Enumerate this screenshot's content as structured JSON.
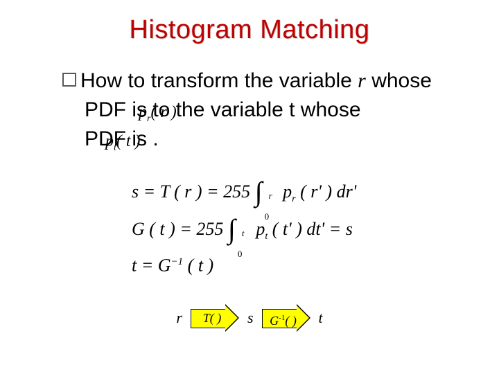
{
  "title": "Histogram Matching",
  "bullet": {
    "line1a": "How to transform the variable ",
    "rvar": "r",
    "line1b": " whose",
    "line2a": "PDF is",
    "pr_label": "p",
    "pr_sub": "r",
    "pr_paren": "( r )",
    "line2b": "   to the variable t whose",
    "line3a": "PDF is",
    "pt_label": "p",
    "pt_sub": "t",
    "pt_paren": "( t )",
    "line3b": "    ."
  },
  "equations": {
    "eq1_lhs": "s = T ( r ) = 255",
    "eq1_int_top": "r",
    "eq1_int_bot": "0",
    "eq1_rhs_a": "p",
    "eq1_rhs_sub": "r",
    "eq1_rhs_b": " ( r' ) dr'",
    "eq2_lhs": "G ( t ) = 255",
    "eq2_int_top": "t",
    "eq2_int_bot": "0",
    "eq2_rhs_a": "p",
    "eq2_rhs_sub": "t",
    "eq2_rhs_b": " ( t' ) dt' = s",
    "eq3_a": "t = G",
    "eq3_sup": "−1",
    "eq3_b": " ( t )"
  },
  "flow": {
    "v1": "r",
    "box1": "T( )",
    "v2": "s",
    "box2_a": "G",
    "box2_sup": "-1",
    "box2_b": "( )",
    "v3": "t"
  }
}
